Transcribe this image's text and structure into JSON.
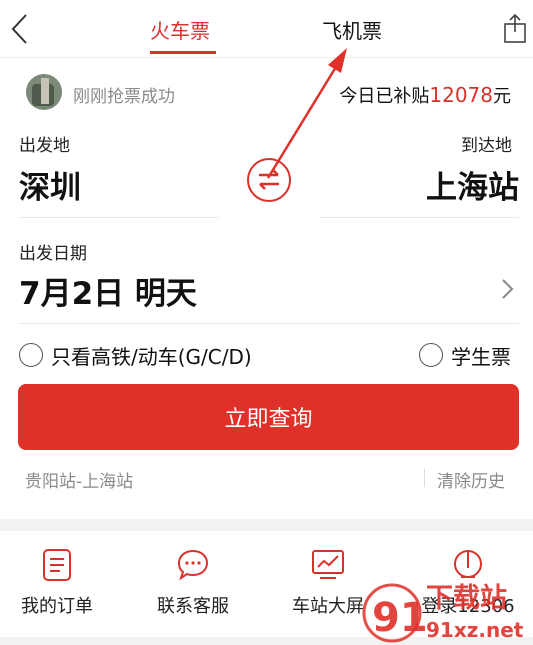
{
  "tabs": {
    "train": "火车票",
    "plane": "飞机票"
  },
  "notice": {
    "text": "刚刚抢票成功",
    "subsidy_prefix": "今日已补贴",
    "subsidy_amount": "12078",
    "subsidy_unit": "元"
  },
  "route": {
    "from_label": "出发地",
    "from_city": "深圳",
    "to_label": "到达地",
    "to_city": "上海站"
  },
  "date": {
    "label": "出发日期",
    "value": "7月2日 明天"
  },
  "options": {
    "high_speed": "只看高铁/动车(G/C/D)",
    "student": "学生票"
  },
  "search_button": "立即查询",
  "history": {
    "item": "贵阳站-上海站",
    "clear": "清除历史"
  },
  "bottom_nav": [
    {
      "label": "我的订单",
      "icon": "order-icon"
    },
    {
      "label": "联系客服",
      "icon": "chat-icon"
    },
    {
      "label": "车站大屏",
      "icon": "screen-icon"
    },
    {
      "label": "登录12306",
      "icon": "login-icon"
    }
  ],
  "watermark": {
    "title": "下载站",
    "site": "91xz.net"
  },
  "colors": {
    "accent": "#d9322c",
    "button": "#e0302a",
    "muted": "#8a8a8a"
  }
}
